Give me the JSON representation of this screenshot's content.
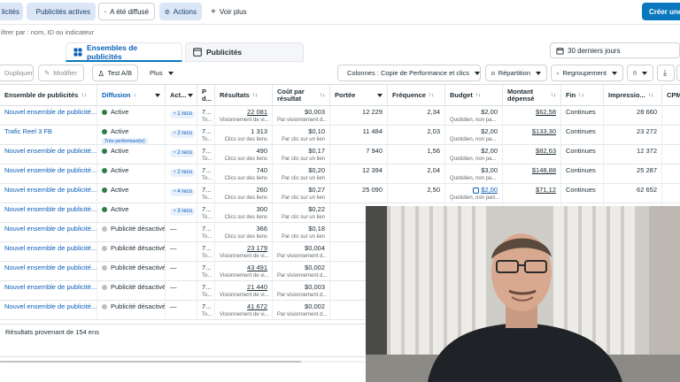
{
  "topbar": {
    "chips": [
      {
        "label": "licités",
        "icon": "none"
      },
      {
        "label": "Publicités actives",
        "icon": "megaphone-icon"
      },
      {
        "label": "A été diffusé",
        "icon": "history-icon"
      },
      {
        "label": "Actions",
        "icon": "bolt-icon"
      },
      {
        "label": "Voir plus",
        "icon": "plus-icon"
      }
    ],
    "create_label": "Créer une v"
  },
  "filter": {
    "placeholder": "iltrer par : nom, ID ou indicateur"
  },
  "tabs": {
    "adsets": "Ensembles de publicités",
    "ads": "Publicités"
  },
  "date_range": "30 derniers jours",
  "toolbar": {
    "duplicate": "Dupliquer",
    "edit": "Modifier",
    "ab_test": "Test A/B",
    "more": "Plus",
    "columns": "Colonnes : Copie de Performance et clics",
    "breakdown": "Répartition",
    "grouping": "Regroupement"
  },
  "table": {
    "headers": {
      "name": "Ensemble de publicités",
      "delivery": "Diffusion",
      "actions": "Act...",
      "p": "P d...",
      "results": "Résultats",
      "cost": "Coût par résultat",
      "reach": "Portée",
      "frequency": "Fréquence",
      "budget": "Budget",
      "spent": "Montant dépensé",
      "end": "Fin",
      "impressions": "Impressio...",
      "cpm": "CPM"
    },
    "rows": [
      {
        "name": "Nouvel ensemble de publicité...",
        "delivery": "Active",
        "status": "green",
        "badge": "",
        "reco": "1 reco",
        "p": "7...",
        "psub": "To...",
        "results": "22 081",
        "results_sub": "Visionnement de vi...",
        "results_ul": true,
        "cost": "$0,003",
        "cost_sub": "Par visionnement d...",
        "reach": "12 229",
        "frequency": "2,34",
        "budget": "$2,00",
        "budget_sub": "Quotidien, non pa...",
        "budget_link": false,
        "spent": "$62,58",
        "end": "Continues",
        "impressions": "28 660"
      },
      {
        "name": "Trafic Reel 3 FB",
        "delivery": "Active",
        "status": "green",
        "badge": "Très performant(e)",
        "reco": "2 reco",
        "p": "7...",
        "psub": "To...",
        "results": "1 313",
        "results_sub": "Clics sur des liens",
        "results_ul": false,
        "cost": "$0,10",
        "cost_sub": "Par clic sur un lien",
        "reach": "11 484",
        "frequency": "2,03",
        "budget": "$2,00",
        "budget_sub": "Quotidien, non pa...",
        "budget_link": false,
        "spent": "$133,30",
        "end": "Continues",
        "impressions": "23 272"
      },
      {
        "name": "Nouvel ensemble de publicité...",
        "delivery": "Active",
        "status": "green",
        "badge": "",
        "reco": "2 reco",
        "p": "7...",
        "psub": "To...",
        "results": "490",
        "results_sub": "Clics sur des liens",
        "results_ul": false,
        "cost": "$0,17",
        "cost_sub": "Par clic sur un lien",
        "reach": "7 940",
        "frequency": "1,56",
        "budget": "$2,00",
        "budget_sub": "Quotidien, non pa...",
        "budget_link": false,
        "spent": "$82,63",
        "end": "Continues",
        "impressions": "12 372"
      },
      {
        "name": "Nouvel ensemble de publicité...",
        "delivery": "Active",
        "status": "green",
        "badge": "",
        "reco": "2 reco",
        "p": "7...",
        "psub": "To...",
        "results": "740",
        "results_sub": "Clics sur des liens",
        "results_ul": false,
        "cost": "$0,20",
        "cost_sub": "Par clic sur un lien",
        "reach": "12 394",
        "frequency": "2,04",
        "budget": "$3,00",
        "budget_sub": "Quotidien, non pa...",
        "budget_link": false,
        "spent": "$148,88",
        "end": "Continues",
        "impressions": "25 287"
      },
      {
        "name": "Nouvel ensemble de publicité...",
        "delivery": "Active",
        "status": "green",
        "badge": "",
        "reco": "4 reco",
        "p": "7...",
        "psub": "To...",
        "results": "260",
        "results_sub": "Clics sur des liens",
        "results_ul": false,
        "cost": "$0,27",
        "cost_sub": "Par clic sur un lien",
        "reach": "25 090",
        "frequency": "2,50",
        "budget": "$2,00",
        "budget_sub": "Quotidien, non part...",
        "budget_link": true,
        "spent": "$71,12",
        "end": "Continues",
        "impressions": "62 652"
      },
      {
        "name": "Nouvel ensemble de publicité...",
        "delivery": "Active",
        "status": "green",
        "badge": "",
        "reco": "3 reco",
        "p": "7...",
        "psub": "To...",
        "results": "300",
        "results_sub": "Clics sur des liens",
        "results_ul": false,
        "cost": "$0,22",
        "cost_sub": "Par clic sur un lien",
        "reach": "",
        "frequency": "",
        "budget": "",
        "budget_sub": "",
        "budget_link": false,
        "spent": "",
        "end": "",
        "impressions": ""
      },
      {
        "name": "Nouvel ensemble de publicité...",
        "delivery": "Publicité désactivé",
        "status": "gray",
        "badge": "",
        "reco": "—",
        "p": "7...",
        "psub": "To...",
        "results": "366",
        "results_sub": "Clics sur des liens",
        "results_ul": false,
        "cost": "$0,18",
        "cost_sub": "Par clic sur un lien",
        "reach": "",
        "frequency": "",
        "budget": "",
        "budget_sub": "",
        "budget_link": false,
        "spent": "",
        "end": "",
        "impressions": ""
      },
      {
        "name": "Nouvel ensemble de publicité...",
        "delivery": "Publicité désactivé",
        "status": "gray",
        "badge": "",
        "reco": "—",
        "p": "7...",
        "psub": "To...",
        "results": "23 179",
        "results_sub": "Visionnement de vi...",
        "results_ul": true,
        "cost": "$0,004",
        "cost_sub": "Par visionnement d...",
        "reach": "",
        "frequency": "",
        "budget": "",
        "budget_sub": "",
        "budget_link": false,
        "spent": "",
        "end": "",
        "impressions": ""
      },
      {
        "name": "Nouvel ensemble de publicité...",
        "delivery": "Publicité désactivé",
        "status": "gray",
        "badge": "",
        "reco": "—",
        "p": "7...",
        "psub": "To...",
        "results": "43 491",
        "results_sub": "Visionnement de vi...",
        "results_ul": true,
        "cost": "$0,002",
        "cost_sub": "Par visionnement d...",
        "reach": "",
        "frequency": "",
        "budget": "",
        "budget_sub": "",
        "budget_link": false,
        "spent": "",
        "end": "",
        "impressions": ""
      },
      {
        "name": "Nouvel ensemble de publicité...",
        "delivery": "Publicité désactivé",
        "status": "gray",
        "badge": "",
        "reco": "—",
        "p": "7...",
        "psub": "To...",
        "results": "21 440",
        "results_sub": "Visionnement de vi...",
        "results_ul": true,
        "cost": "$0,003",
        "cost_sub": "Par visionnement d...",
        "reach": "",
        "frequency": "",
        "budget": "",
        "budget_sub": "",
        "budget_link": false,
        "spent": "",
        "end": "",
        "impressions": ""
      },
      {
        "name": "Nouvel ensemble de publicité...",
        "delivery": "Publicité désactivé",
        "status": "gray",
        "badge": "",
        "reco": "—",
        "p": "7...",
        "psub": "To...",
        "results": "41 672",
        "results_sub": "Visionnement de vi...",
        "results_ul": true,
        "cost": "$0,002",
        "cost_sub": "Par visionnement d...",
        "reach": "",
        "frequency": "",
        "budget": "",
        "budget_sub": "",
        "budget_link": false,
        "spent": "",
        "end": "",
        "impressions": ""
      }
    ],
    "footer": "Résultats provenant de 154 ens"
  },
  "colors": {
    "accent": "#0a78be",
    "link": "#0a5eb8",
    "active_status": "#2d7d46",
    "inactive_status": "#bcc0c4",
    "chip_active_bg": "#dbe7f6"
  }
}
